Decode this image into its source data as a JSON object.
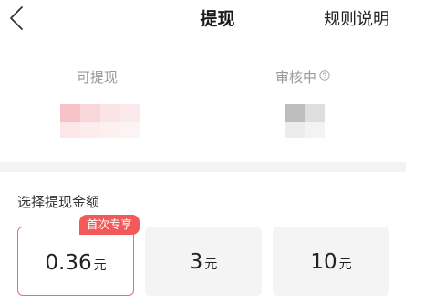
{
  "header": {
    "back_icon": "chevron-left-icon",
    "title": "提现",
    "rules_label": "规则说明"
  },
  "balances": {
    "available_label": "可提现",
    "pending_label": "审核中",
    "help_icon": "question-circle-icon"
  },
  "section_label": "选择提现金额",
  "options": [
    {
      "amount": "0.36",
      "unit": "元",
      "selected": true,
      "badge": "首次专享"
    },
    {
      "amount": "3",
      "unit": "元",
      "selected": false
    },
    {
      "amount": "10",
      "unit": "元",
      "selected": false
    }
  ],
  "colors": {
    "accent": "#f25a5a",
    "selected_border": "#f26a6a",
    "option_bg": "#f4f4f4",
    "muted_text": "#999999"
  }
}
